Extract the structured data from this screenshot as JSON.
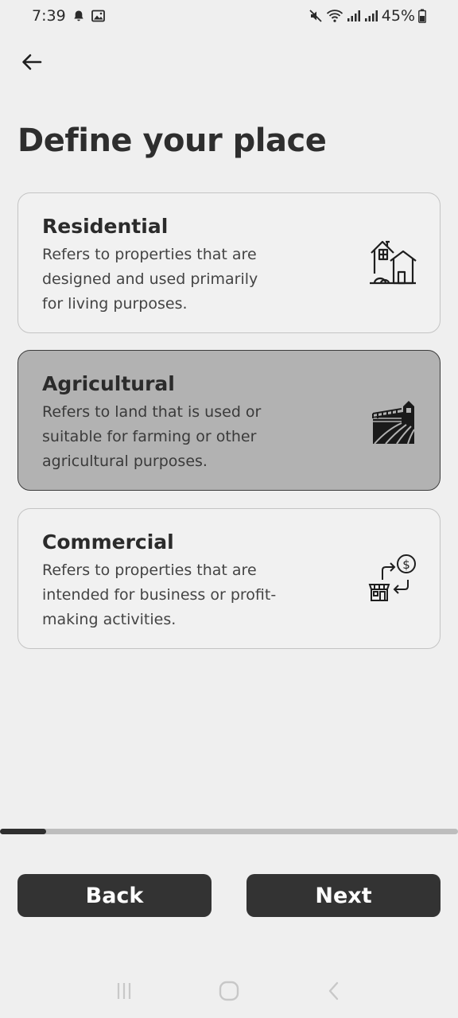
{
  "status_bar": {
    "time": "7:39",
    "battery": "45%",
    "icons": [
      "bell-icon",
      "image-icon",
      "mute-icon",
      "wifi-icon",
      "signal-icon",
      "signal-icon",
      "battery-icon"
    ]
  },
  "header": {
    "back_icon": "arrow-left-icon",
    "title": "Define your place"
  },
  "options": [
    {
      "title": "Residential",
      "description": "Refers to properties that are designed and used primarily for living purposes.",
      "icon": "house-icon",
      "selected": false
    },
    {
      "title": "Agricultural",
      "description": "Refers to land that is used or suitable for farming or other agricultural purposes.",
      "icon": "farm-icon",
      "selected": true
    },
    {
      "title": "Commercial",
      "description": "Refers to properties that are intended for business or profit-making activities.",
      "icon": "store-exchange-icon",
      "selected": false
    }
  ],
  "progress": {
    "fraction": 0.1
  },
  "footer": {
    "back_label": "Back",
    "next_label": "Next"
  },
  "colors": {
    "background": "#efefef",
    "selected_card": "#b2b2b2",
    "button": "#333333",
    "button_text": "#ffffff"
  }
}
